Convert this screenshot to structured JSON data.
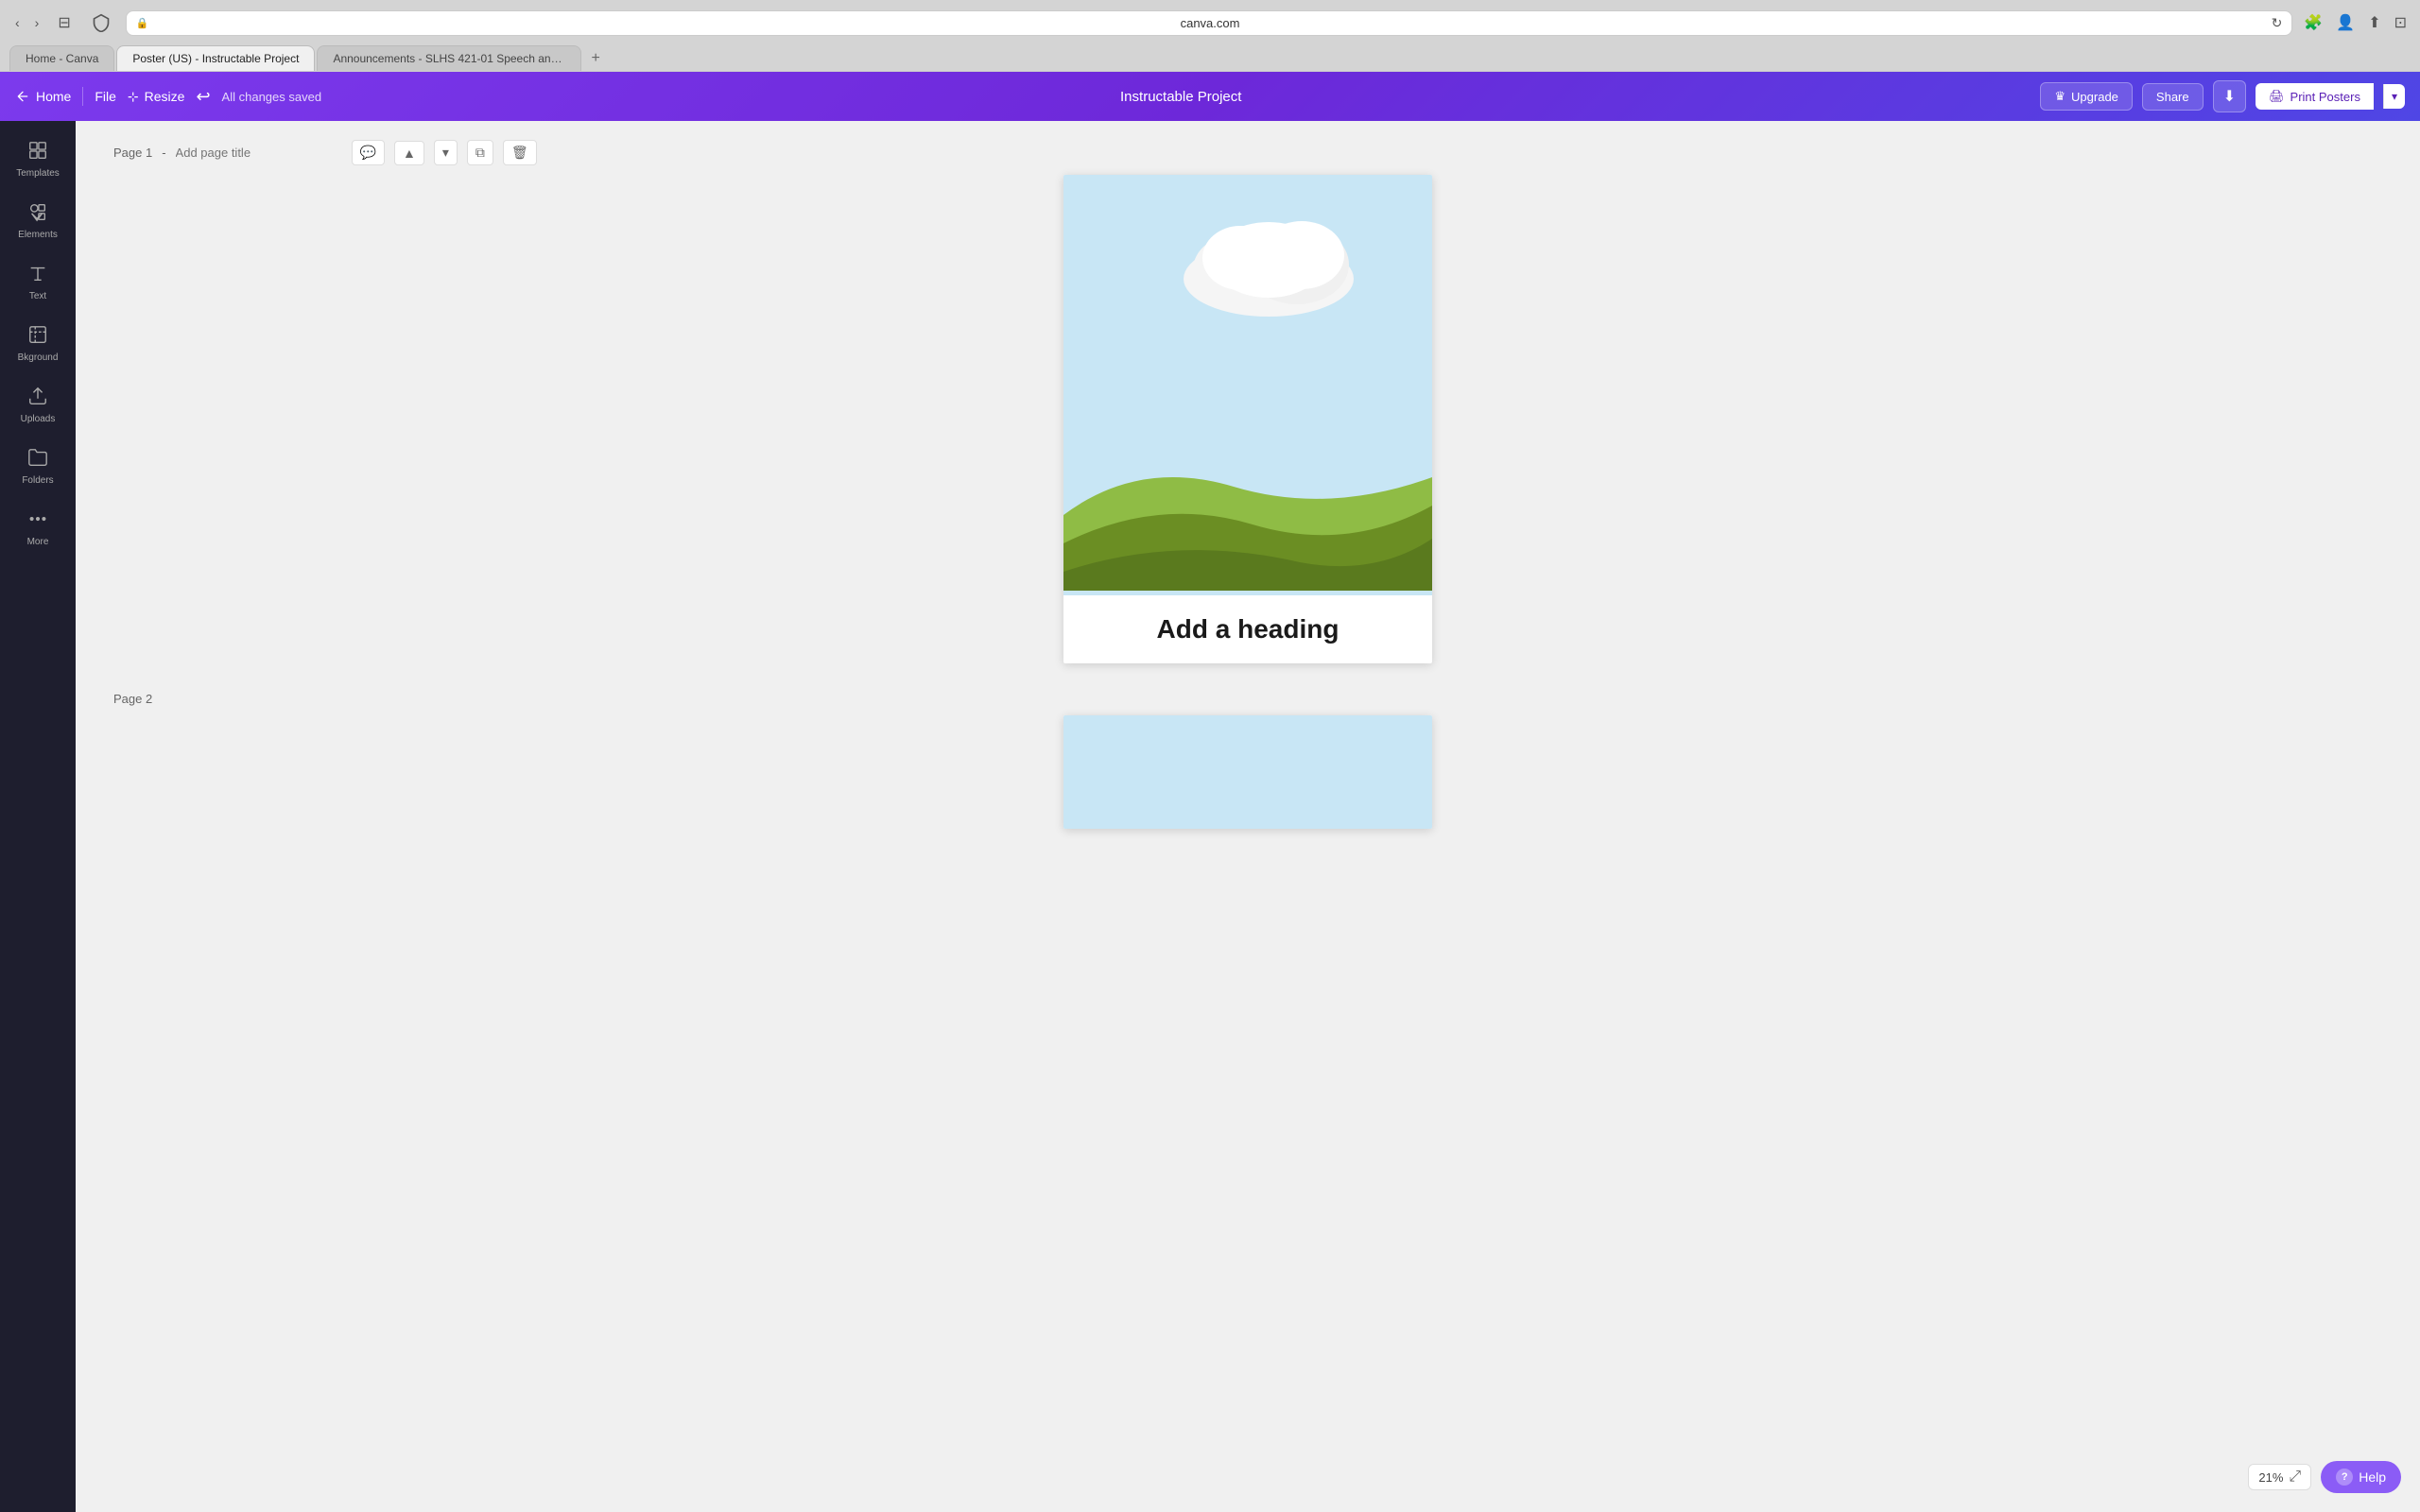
{
  "browser": {
    "url": "canva.com",
    "tabs": [
      {
        "id": "home",
        "label": "Home - Canva",
        "active": false
      },
      {
        "id": "poster",
        "label": "Poster (US) - Instructable Project",
        "active": true
      },
      {
        "id": "announcements",
        "label": "Announcements - SLHS 421-01 Speech and Voice Science Spring 2...",
        "active": false
      }
    ]
  },
  "topbar": {
    "home_label": "Home",
    "file_label": "File",
    "resize_label": "Resize",
    "undo_symbol": "↩",
    "changes_saved": "All changes saved",
    "project_title": "Instructable Project",
    "upgrade_label": "Upgrade",
    "share_label": "Share",
    "download_symbol": "⬇",
    "print_label": "Print Posters",
    "print_arrow": "▾",
    "crown_symbol": "♛"
  },
  "sidebar": {
    "items": [
      {
        "id": "templates",
        "label": "Templates",
        "icon": "templates"
      },
      {
        "id": "elements",
        "label": "Elements",
        "icon": "elements"
      },
      {
        "id": "text",
        "label": "Text",
        "icon": "text"
      },
      {
        "id": "background",
        "label": "Bkground",
        "icon": "background"
      },
      {
        "id": "uploads",
        "label": "Uploads",
        "icon": "uploads"
      },
      {
        "id": "folders",
        "label": "Folders",
        "icon": "folders"
      },
      {
        "id": "more",
        "label": "More",
        "icon": "more"
      }
    ]
  },
  "canvas": {
    "page1": {
      "label": "Page 1",
      "title_placeholder": "Add page title",
      "heading_text": "Add a heading",
      "sky_color": "#c8e6f5",
      "cloud_color": "#f0f0f0",
      "hill1_color": "#8fbc45",
      "hill2_color": "#6b8e23",
      "hill3_color": "#5a7a1e"
    },
    "page2": {
      "label": "Page 2",
      "sky_color": "#c8e6f5"
    }
  },
  "footer": {
    "zoom_level": "21%",
    "expand_icon": "⤢",
    "help_label": "Help",
    "help_icon": "?"
  },
  "page_actions": {
    "comment_icon": "💬",
    "up_icon": "▲",
    "down_icon": "▾",
    "duplicate_icon": "⧉",
    "delete_icon": "🗑"
  }
}
